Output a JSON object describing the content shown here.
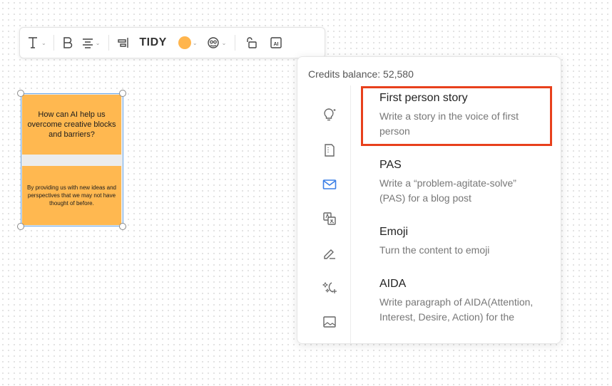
{
  "toolbar": {
    "text_icon": "text-T-icon",
    "bold_icon": "bold-B-icon",
    "align_icon": "align-center-icon",
    "layout_icon": "align-right-icon",
    "tidy_label": "TIDY",
    "fill_color": "#FFB54D",
    "style_icon": "sticker-style-icon",
    "lock_icon": "unlock-icon",
    "ai_icon": "ai-square-icon"
  },
  "canvas": {
    "card_question": "How can AI help us overcome creative blocks and barriers?",
    "card_answer": "By providing us with new ideas and perspectives that we may not have thought of before."
  },
  "ai_panel": {
    "credits_label": "Credits balance: 52,580",
    "categories": [
      {
        "icon": "lightbulb-icon",
        "active": false
      },
      {
        "icon": "document-icon",
        "active": false
      },
      {
        "icon": "mail-icon",
        "active": true
      },
      {
        "icon": "translate-icon",
        "active": false
      },
      {
        "icon": "edit-pen-icon",
        "active": false
      },
      {
        "icon": "magic-wand-icon",
        "active": false
      },
      {
        "icon": "image-icon",
        "active": false
      }
    ],
    "prompts": [
      {
        "title": "First person story",
        "description": "Write a story in the voice of first person"
      },
      {
        "title": "PAS",
        "description": "Write a “problem-agitate-solve” (PAS) for a blog post"
      },
      {
        "title": "Emoji",
        "description": "Turn the content to emoji"
      },
      {
        "title": "AIDA",
        "description": "Write paragraph of AIDA(Attention, Interest, Desire, Action) for the"
      }
    ],
    "accent_color": "#3A7FE6",
    "highlight_color": "#E8401C"
  }
}
